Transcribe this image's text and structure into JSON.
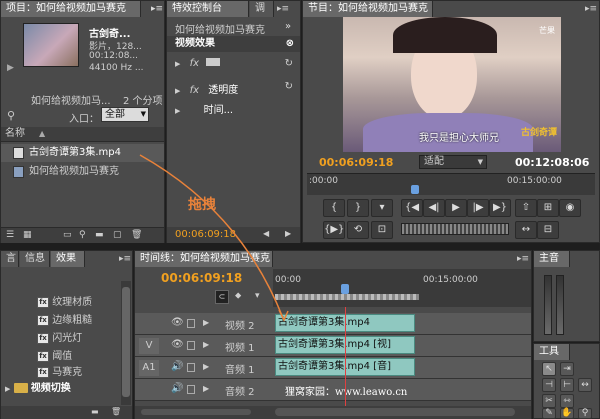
{
  "project": {
    "tab": "项目：如何给视频加马赛克",
    "clip_title": "古剑奇...",
    "clip_info": [
      "影片，128...",
      "00:12:08...",
      "44100 Hz ..."
    ],
    "project_name": "如何给视频加马...",
    "items_count": "2 个分项",
    "entry_label": "入口：",
    "entry_value": "全部",
    "column_name": "名称",
    "items": [
      "古剑奇谭第3集.mp4",
      "如何给视频加马赛克"
    ]
  },
  "effect_controls": {
    "tab": "特效控制台",
    "tab2": "调",
    "sequence": "如何给视频加马赛克",
    "header": "视频效果",
    "rows": [
      {
        "fx": "fx",
        "name": ""
      },
      {
        "fx": "fx",
        "name": "透明度"
      },
      {
        "fx": "",
        "name": "时间..."
      }
    ],
    "timecode": "00:06:09:18"
  },
  "program": {
    "tab": "节目：如何给视频加马赛克",
    "subtitle": "我只是担心大师兄",
    "watermark_tr": "芒果",
    "watermark_br": "古剑奇谭",
    "timecode_left": "00:06:09:18",
    "fit": "适配",
    "timecode_right": "00:12:08:06",
    "ruler_left": ":00:00",
    "ruler_mid": "00:15:00:00"
  },
  "annotation": {
    "text": "拖拽"
  },
  "effects_panel": {
    "tabs": [
      "言",
      "信息",
      "效果"
    ],
    "items": [
      "纹理材质",
      "边缘粗糙",
      "闪光灯",
      "阈值",
      "马赛克"
    ],
    "folder": "视频切换"
  },
  "timeline": {
    "tab": "时间线：如何给视频加马赛克",
    "timecode": "00:06:09:18",
    "ruler_left": "00:00",
    "ruler_mid": "00:15:00:00",
    "tracks": [
      {
        "label": "视频 2",
        "side": "",
        "clip": "古剑奇谭第3集.mp4"
      },
      {
        "label": "视频 1",
        "side": "V",
        "clip": "古剑奇谭第3集.mp4 [视]"
      },
      {
        "label": "音频 1",
        "side": "A1",
        "clip": "古剑奇谭第3集.mp4 [音]"
      },
      {
        "label": "音频 2",
        "side": "",
        "clip": ""
      }
    ],
    "watermark": "狸窝家园：www.leawo.cn"
  },
  "audio_panel": {
    "tab": "主音"
  },
  "tools_panel": {
    "tab": "工具"
  },
  "colors": {
    "accent": "#f0a020",
    "clip": "#8fc8c0",
    "annotation": "#e8823a"
  }
}
